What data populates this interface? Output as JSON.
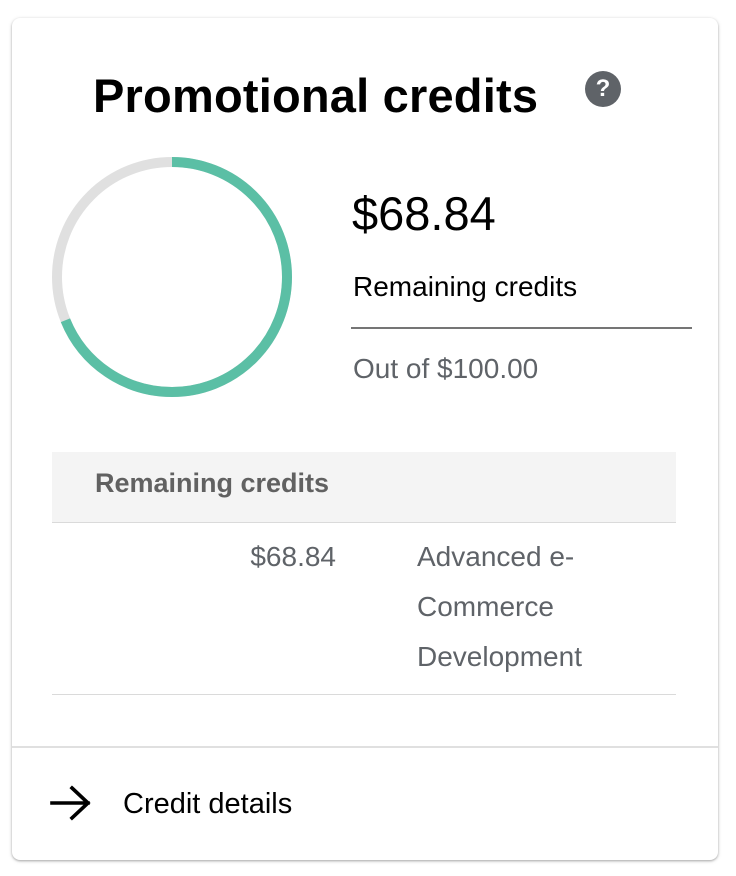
{
  "card": {
    "title": "Promotional credits",
    "help_icon": "help-circle-icon",
    "help_glyph": "?"
  },
  "summary": {
    "amount": "$68.84",
    "amount_label": "Remaining credits",
    "total_text": "Out of $100.00",
    "remaining_fraction": 0.6884,
    "colors": {
      "remaining": "#5bbfa5",
      "used": "#e0e0e0"
    }
  },
  "table": {
    "header": "Remaining credits",
    "rows": [
      {
        "amount": "$68.84",
        "name": "Advanced e-Commerce Development"
      }
    ]
  },
  "footer": {
    "icon": "arrow-right-icon",
    "label": "Credit details"
  }
}
